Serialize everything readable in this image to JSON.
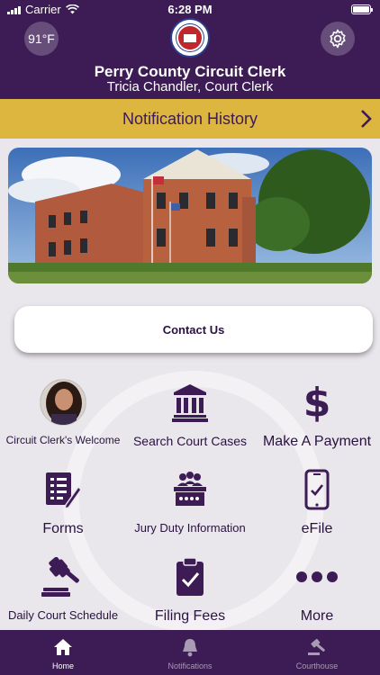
{
  "status": {
    "carrier": "Carrier",
    "time": "6:28 PM"
  },
  "header": {
    "temperature": "91°F",
    "title": "Perry County Circuit Clerk",
    "subtitle": "Tricia Chandler, Court Clerk"
  },
  "notification_bar": {
    "label": "Notification History"
  },
  "contact": {
    "label": "Contact Us"
  },
  "menu": [
    {
      "label": "Circuit Clerk's Welcome",
      "icon": "clerk-photo-avatar"
    },
    {
      "label": "Search Court Cases",
      "icon": "courthouse-icon"
    },
    {
      "label": "Make A Payment",
      "icon": "dollar-icon"
    },
    {
      "label": "Forms",
      "icon": "forms-icon"
    },
    {
      "label": "Jury Duty Information",
      "icon": "jury-box-icon"
    },
    {
      "label": "eFile",
      "icon": "phone-check-icon"
    },
    {
      "label": "Daily Court Schedule",
      "icon": "gavel-icon"
    },
    {
      "label": "Filing Fees",
      "icon": "clipboard-check-icon"
    },
    {
      "label": "More",
      "icon": "more-dots-icon"
    }
  ],
  "tabs": [
    {
      "label": "Home",
      "icon": "home-icon",
      "active": true
    },
    {
      "label": "Notifications",
      "icon": "bell-icon",
      "active": false
    },
    {
      "label": "Courthouse",
      "icon": "gavel-icon",
      "active": false
    }
  ],
  "colors": {
    "primary": "#3d1b55",
    "accent": "#ddb640",
    "background": "#e9e6ec"
  }
}
